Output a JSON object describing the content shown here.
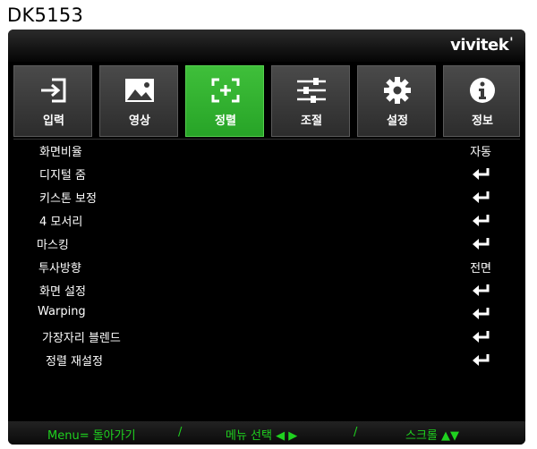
{
  "header": {
    "model": "DK5153",
    "brand": "vivitek"
  },
  "tabs": [
    {
      "label": "입력",
      "icon": "input-icon",
      "active": false
    },
    {
      "label": "영상",
      "icon": "image-icon",
      "active": false
    },
    {
      "label": "정렬",
      "icon": "alignment-icon",
      "active": true
    },
    {
      "label": "조절",
      "icon": "sliders-icon",
      "active": false
    },
    {
      "label": "설정",
      "icon": "gear-icon",
      "active": false
    },
    {
      "label": "정보",
      "icon": "info-icon",
      "active": false
    }
  ],
  "menu": [
    {
      "label": "화면비율",
      "value": "자동",
      "icon": ""
    },
    {
      "label": "디지털 줌",
      "value": "",
      "icon": "enter-icon"
    },
    {
      "label": "키스톤 보정",
      "value": "",
      "icon": "enter-icon"
    },
    {
      "label": "4 모서리",
      "value": "",
      "icon": "enter-icon"
    },
    {
      "label": "마스킹",
      "value": "",
      "icon": "enter-icon"
    },
    {
      "label": "투사방향",
      "value": "전면",
      "icon": ""
    },
    {
      "label": "화면 설정",
      "value": "",
      "icon": "enter-icon"
    },
    {
      "label": "Warping",
      "value": "",
      "icon": "enter-icon"
    },
    {
      "label": "가장자리 블렌드",
      "value": "",
      "icon": "enter-icon"
    },
    {
      "label": "정렬 재설정",
      "value": "",
      "icon": "enter-icon"
    }
  ],
  "footer": {
    "menu_back": "Menu= 돌아가기",
    "sep1": "/",
    "menu_select": "메뉴 선택 ◀ ▶",
    "sep2": "/",
    "scroll": "스크롤 ▲▼"
  },
  "colors": {
    "active_tab": "#33b233",
    "footer_text": "#1fd11f",
    "background": "#000000"
  }
}
